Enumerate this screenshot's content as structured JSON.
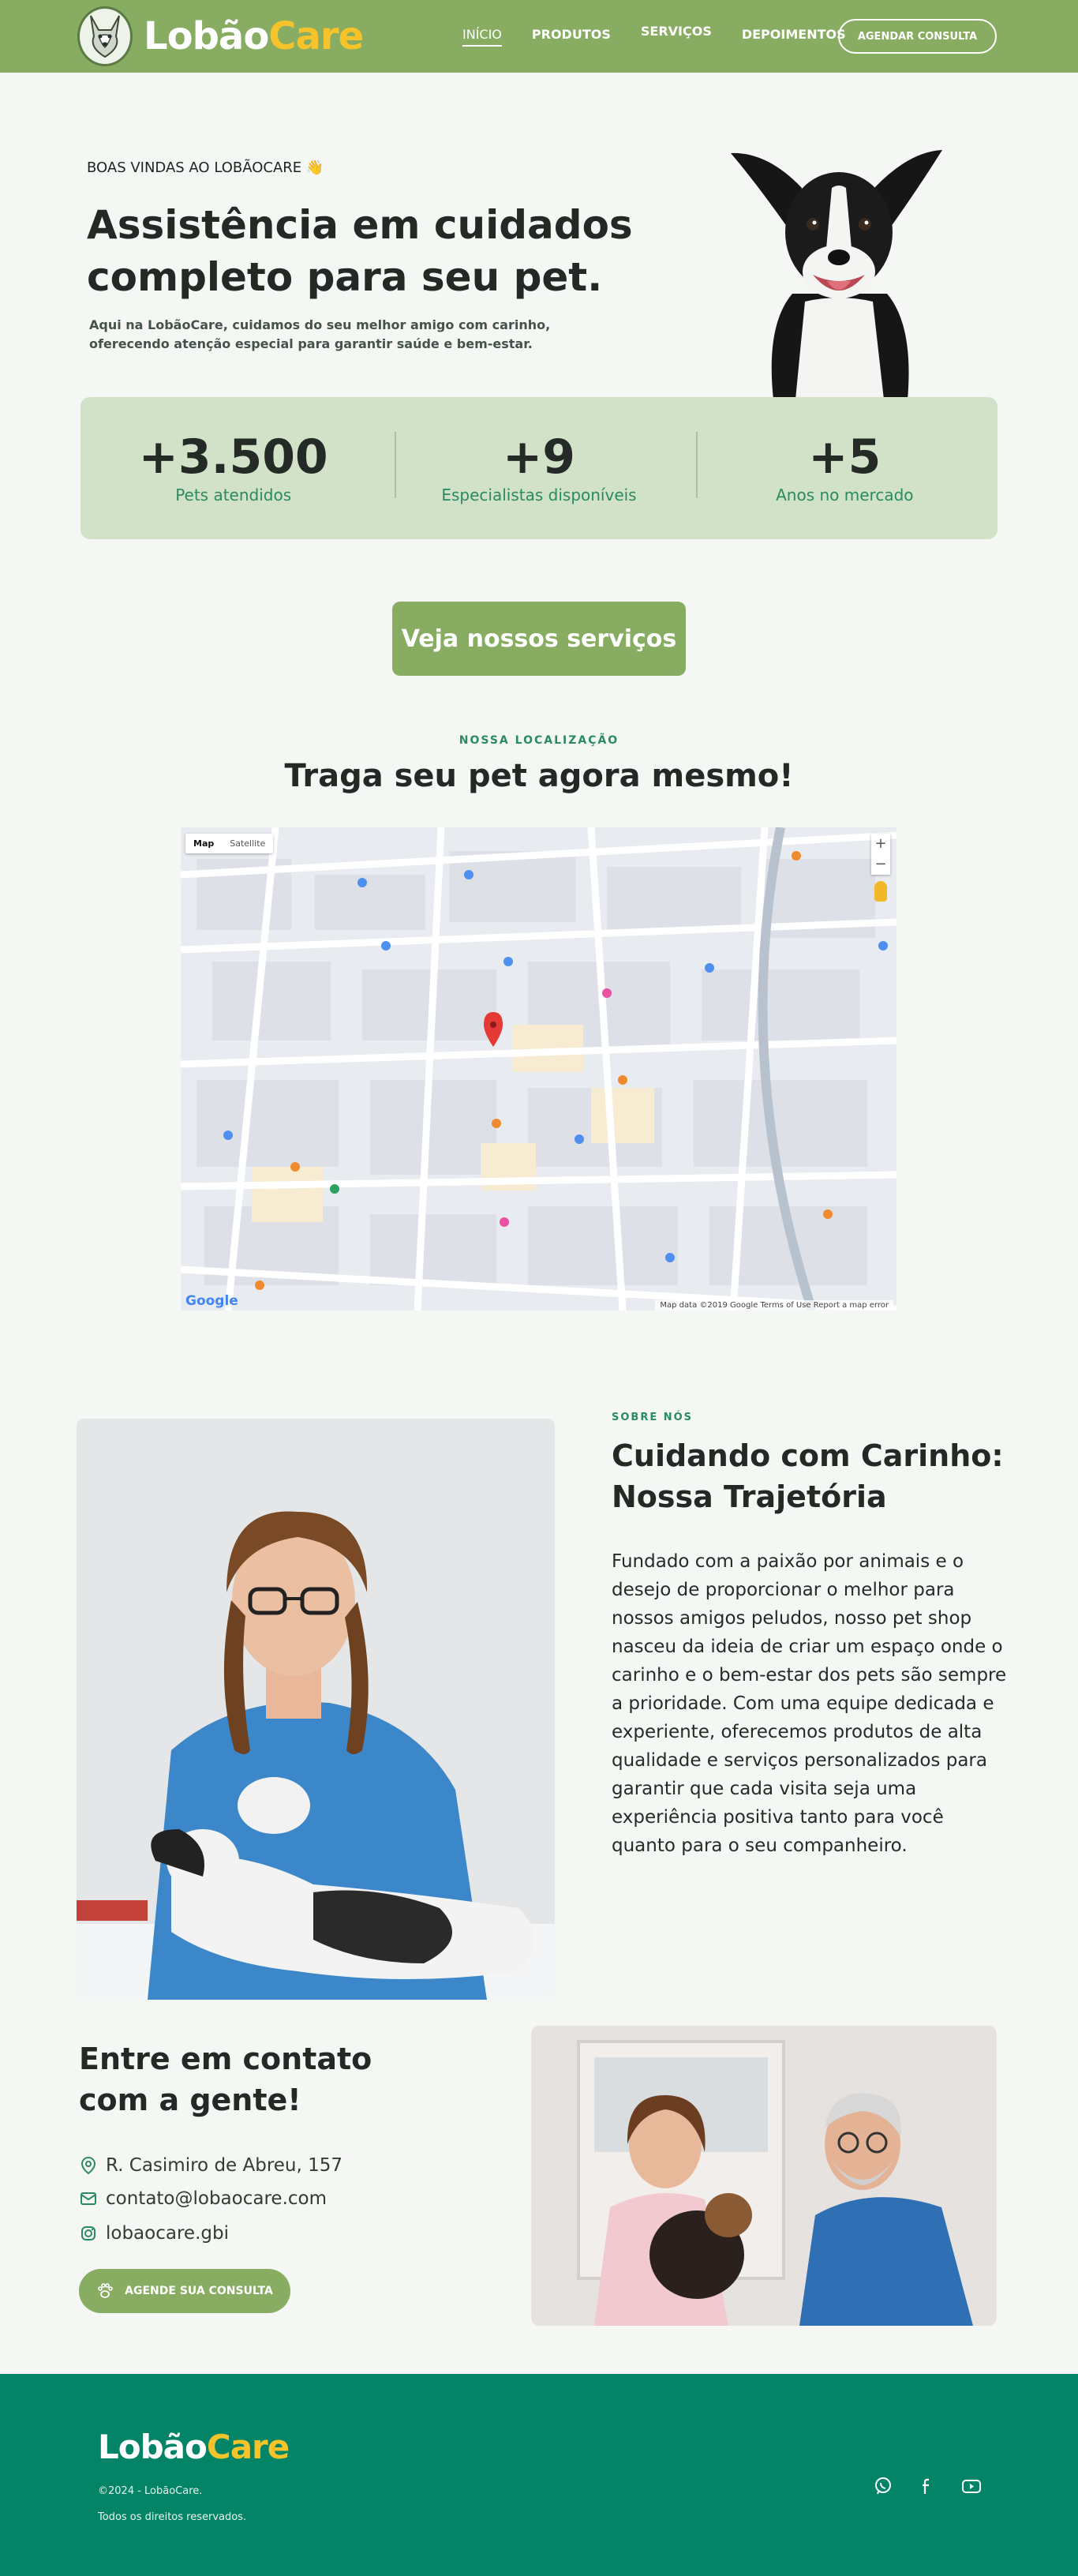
{
  "brand": {
    "name_part1": "Lobão",
    "name_part2": "Care"
  },
  "nav": {
    "items": [
      {
        "label": "INÍCIO",
        "active": true
      },
      {
        "label": "PRODUTOS",
        "active": false
      },
      {
        "label": "SERVIÇOS",
        "active": false
      },
      {
        "label": "DEPOIMENTOS",
        "active": false
      }
    ],
    "cta": "AGENDAR CONSULTA"
  },
  "hero": {
    "kicker": "BOAS VINDAS AO LOBÃOCARE 👋",
    "title": "Assistência em cuidados completo para seu pet.",
    "subtitle": "Aqui na LobãoCare, cuidamos do seu melhor amigo com carinho, oferecendo atenção especial para garantir saúde e bem-estar."
  },
  "stats": [
    {
      "value": "+3.500",
      "label": "Pets atendidos"
    },
    {
      "value": "+9",
      "label": "Especialistas disponíveis"
    },
    {
      "value": "+5",
      "label": "Anos no mercado"
    }
  ],
  "services_button": "Veja nossos serviços",
  "location": {
    "kicker": "NOSSA LOCALIZAÇÃO",
    "title": "Traga seu pet agora mesmo!",
    "map": {
      "tab_map": "Map",
      "tab_satellite": "Satellite",
      "zoom_in": "+",
      "zoom_out": "−",
      "footer": "Map data ©2019 Google   Terms of Use   Report a map error",
      "google": "Google"
    }
  },
  "about": {
    "kicker": "SOBRE NÓS",
    "title": "Cuidando com Carinho: Nossa Trajetória",
    "text": "Fundado com a paixão por animais e o desejo de proporcionar o melhor para nossos amigos peludos, nosso pet shop nasceu da ideia de criar um espaço onde o carinho e o bem-estar dos pets são sempre a prioridade. Com uma equipe dedicada e experiente, oferecemos produtos de alta qualidade e serviços personalizados para garantir que cada visita seja uma experiência positiva tanto para você quanto para o seu companheiro."
  },
  "contact": {
    "title": "Entre em contato com a gente!",
    "address": "R. Casimiro de Abreu, 157",
    "email": "contato@lobaocare.com",
    "instagram": "lobaocare.gbi",
    "button": "AGENDE SUA CONSULTA"
  },
  "footer": {
    "copyright": "©2024 - LobãoCare.",
    "rights": "Todos os direitos reservados.",
    "social_icons": [
      "whatsapp-icon",
      "facebook-icon",
      "youtube-icon"
    ]
  },
  "colors": {
    "header_green": "#88ad62",
    "accent_yellow": "#f6c32b",
    "teal": "#2a8a61",
    "footer_teal": "#038466",
    "stats_bg": "#d2e2c8"
  }
}
